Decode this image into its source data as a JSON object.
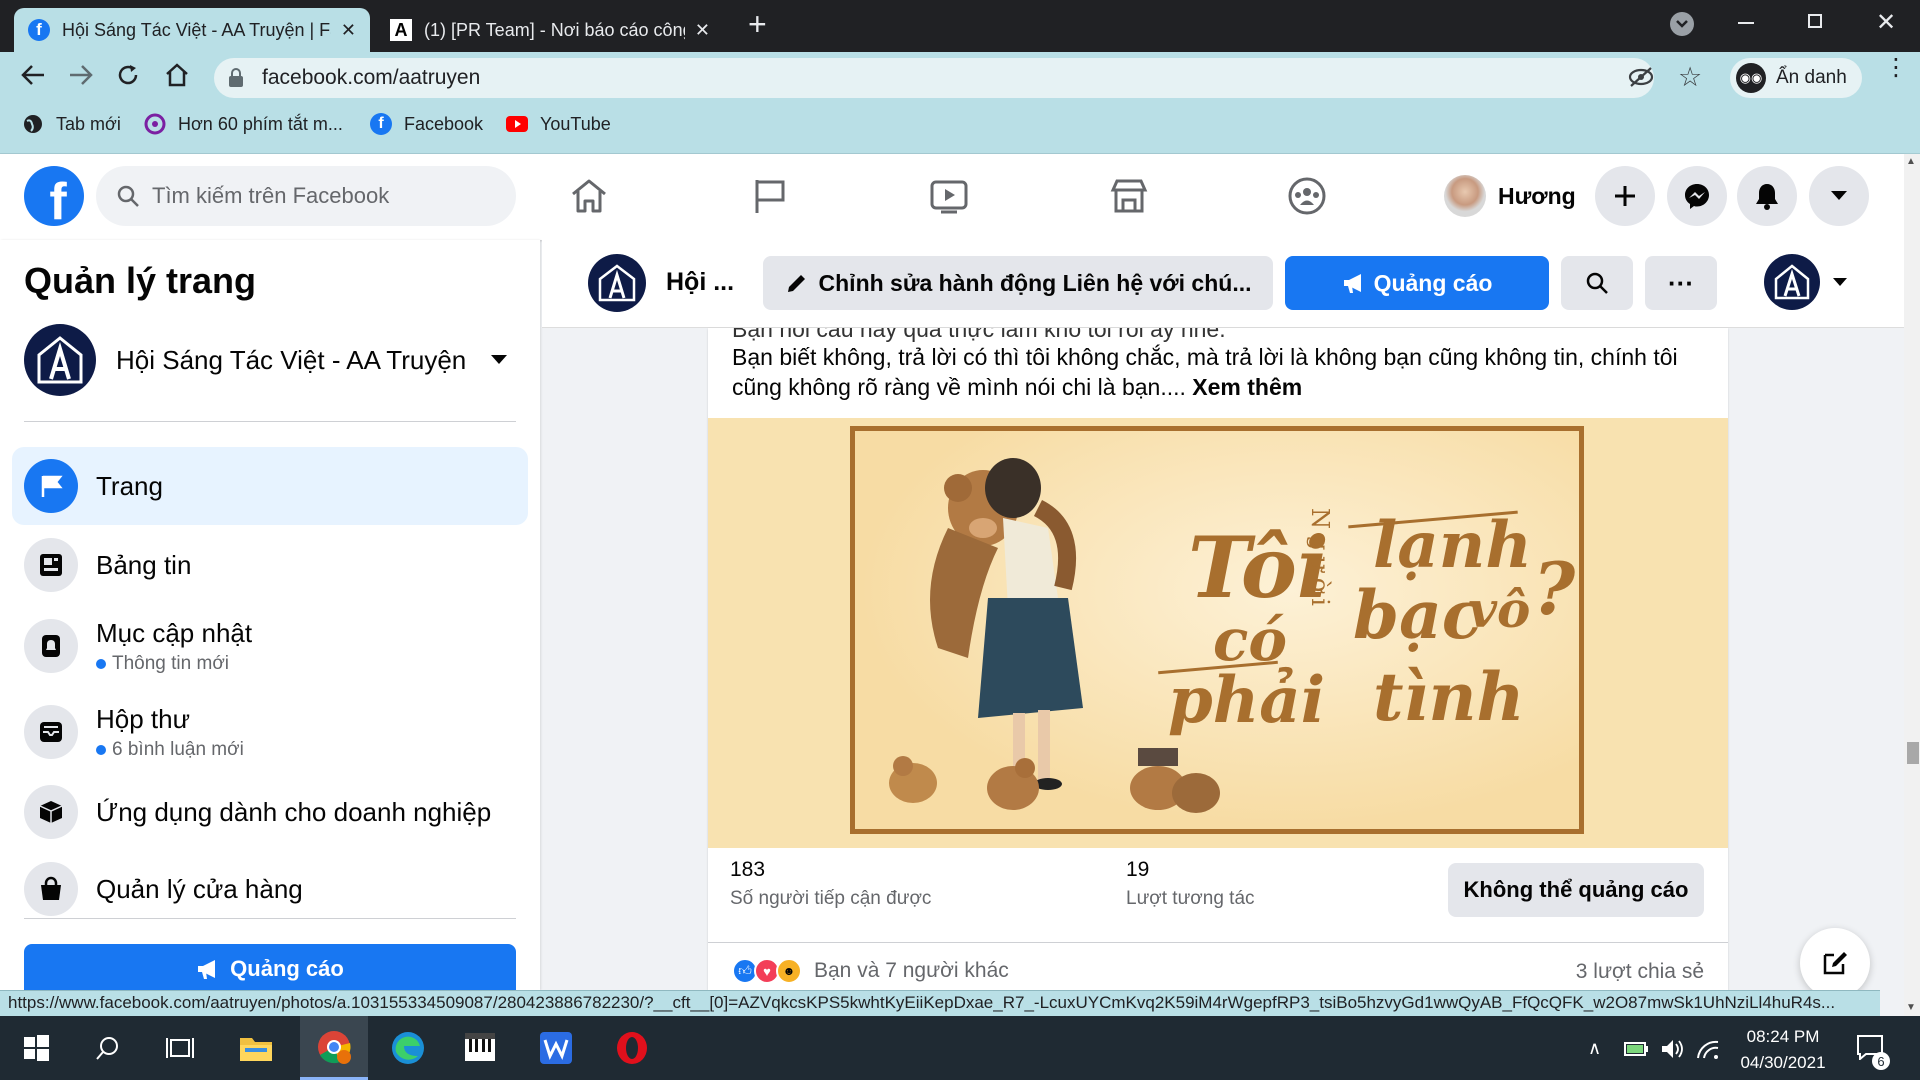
{
  "browser": {
    "tabs": [
      {
        "title": "Hội Sáng Tác Việt - AA Truyện | Fa",
        "close": "✕"
      },
      {
        "title": "(1) [PR Team] - Nơi báo cáo công",
        "close": "✕"
      }
    ],
    "new_tab": "+",
    "url": "facebook.com/aatruyen",
    "profile_label": "Ẩn danh",
    "bookmarks": [
      {
        "label": "Tab mới"
      },
      {
        "label": "Hơn 60 phím tắt m..."
      },
      {
        "label": "Facebook"
      },
      {
        "label": "YouTube"
      }
    ],
    "status_url": "https://www.facebook.com/aatruyen/photos/a.103155334509087/280423886782230/?__cft__[0]=AZVqkcsKPS5kwhtKyEiiKepDxae_R7_-LcuxUYCmKvq2K59iM4rWgepfRP3_tsiBo5hzvyGd1wwQyAB_FfQcQFK_w2O87mwSk1UhNziLl4huR4s..."
  },
  "fb": {
    "search_placeholder": "Tìm kiếm trên Facebook",
    "user_name": "Hương",
    "colors": {
      "brand": "#1877f2",
      "bg": "#f0f2f5"
    }
  },
  "sidebar": {
    "title": "Quản lý trang",
    "page_name": "Hội Sáng Tác Việt - AA Truyện",
    "items": [
      {
        "label": "Trang",
        "sub": ""
      },
      {
        "label": "Bảng tin",
        "sub": ""
      },
      {
        "label": "Mục cập nhật",
        "sub": "Thông tin mới"
      },
      {
        "label": "Hộp thư",
        "sub": "6 bình luận mới"
      },
      {
        "label": "Ứng dụng dành cho doanh nghiệp",
        "sub": ""
      },
      {
        "label": "Quản lý cửa hàng",
        "sub": ""
      }
    ],
    "ad_button": "Quảng cáo"
  },
  "pagebar": {
    "name_short": "Hội ...",
    "edit_button": "Chỉnh sửa hành động Liên hệ với chú...",
    "ad_button": "Quảng cáo",
    "more": "···"
  },
  "post": {
    "text_cut": "Bạn nói câu hay quá thực làm khó tôi rồi ấy nhe.",
    "text_line1": "Bạn biết không, trả lời có thì tôi không chắc, mà trả lời là không bạn cũng không tin, chính tôi",
    "text_line2": "cũng không rõ ràng về mình nói chi là bạn....",
    "see_more": "Xem thêm",
    "image_text": {
      "a": "Tôi",
      "b": "có",
      "c": "phải",
      "d": "Người",
      "e": "lạnh",
      "f": "bạc",
      "g": "vô",
      "h": "tình",
      "q": "?"
    },
    "reach": "183",
    "reach_label": "Số người tiếp cận được",
    "engagement": "19",
    "engagement_label": "Lượt tương tác",
    "no_ad_button": "Không thể quảng cáo",
    "reactions_text": "Bạn và 7 người khác",
    "shares": "3 lượt chia sẻ"
  },
  "taskbar": {
    "time": "08:24 PM",
    "date": "04/30/2021",
    "notif_count": "6"
  }
}
